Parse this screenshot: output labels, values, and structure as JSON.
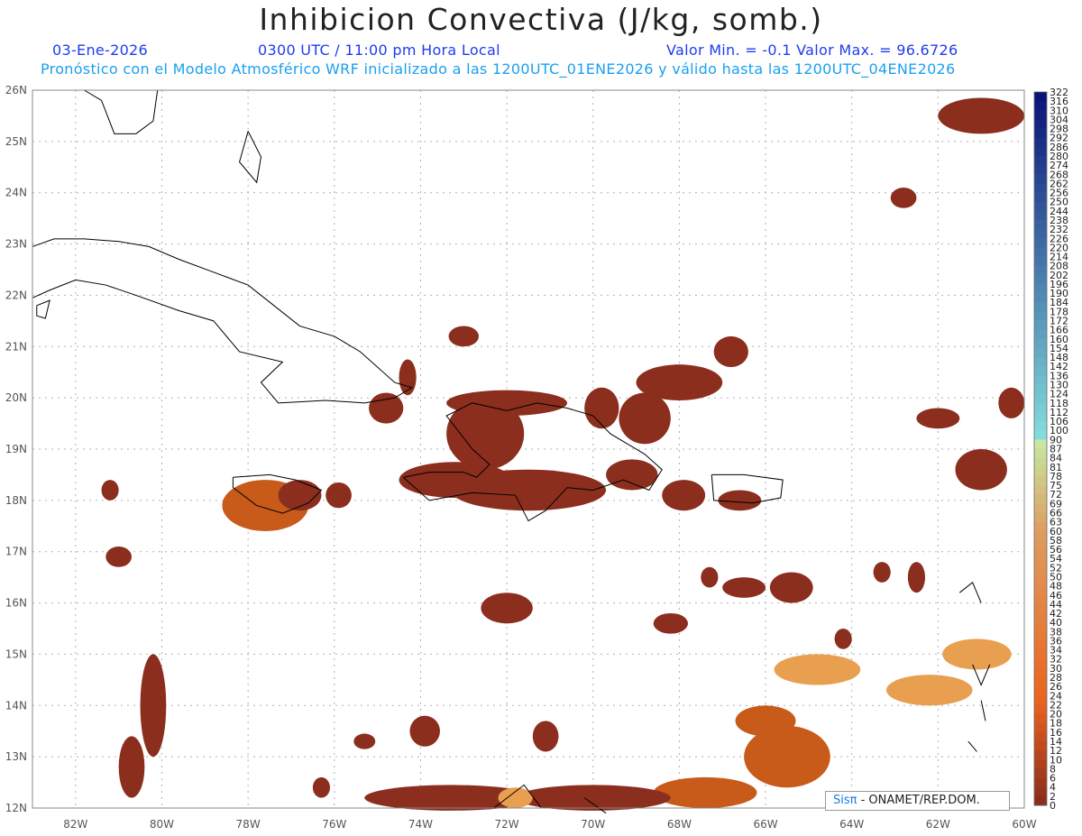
{
  "header": {
    "title": "Inhibicion Convectiva (J/kg, somb.)",
    "date": "03-Ene-2026",
    "time": "0300 UTC / 11:00 pm Hora Local",
    "minmax": "Valor Min. = -0.1  Valor Max. = 96.6726",
    "forecast": "Pronóstico con el Modelo Atmosférico WRF inicializado a las 1200UTC_01ENE2026 y válido hasta las  1200UTC_04ENE2026"
  },
  "map": {
    "lon_range": [
      -83,
      -60
    ],
    "lat_range": [
      12,
      26
    ],
    "lon_ticks": [
      "82W",
      "80W",
      "78W",
      "76W",
      "74W",
      "72W",
      "70W",
      "68W",
      "66W",
      "64W",
      "62W",
      "60W"
    ],
    "lat_ticks": [
      "12N",
      "13N",
      "14N",
      "15N",
      "16N",
      "17N",
      "18N",
      "19N",
      "20N",
      "21N",
      "22N",
      "23N",
      "24N",
      "25N",
      "26N"
    ],
    "grid": true
  },
  "colorbar": {
    "labels": [
      "322",
      "316",
      "310",
      "304",
      "298",
      "292",
      "286",
      "280",
      "274",
      "268",
      "262",
      "256",
      "250",
      "244",
      "238",
      "232",
      "226",
      "220",
      "214",
      "208",
      "202",
      "196",
      "190",
      "184",
      "178",
      "172",
      "166",
      "160",
      "154",
      "148",
      "142",
      "136",
      "130",
      "124",
      "118",
      "112",
      "106",
      "100",
      "90",
      "87",
      "84",
      "81",
      "78",
      "75",
      "72",
      "69",
      "66",
      "63",
      "60",
      "58",
      "56",
      "54",
      "52",
      "50",
      "48",
      "46",
      "44",
      "42",
      "40",
      "38",
      "36",
      "34",
      "32",
      "30",
      "28",
      "26",
      "24",
      "22",
      "20",
      "18",
      "16",
      "14",
      "12",
      "10",
      "8",
      "6",
      "4",
      "2",
      "0"
    ]
  },
  "credit": {
    "sis": "Sisπ",
    "org": " - ONAMET/REP.DOM."
  },
  "colors": {
    "shade_low": "#8b2e1e",
    "shade_mid": "#c85a1a",
    "shade_high": "#e8a050",
    "coast": "#000000",
    "grid": "#b0b0b0"
  }
}
